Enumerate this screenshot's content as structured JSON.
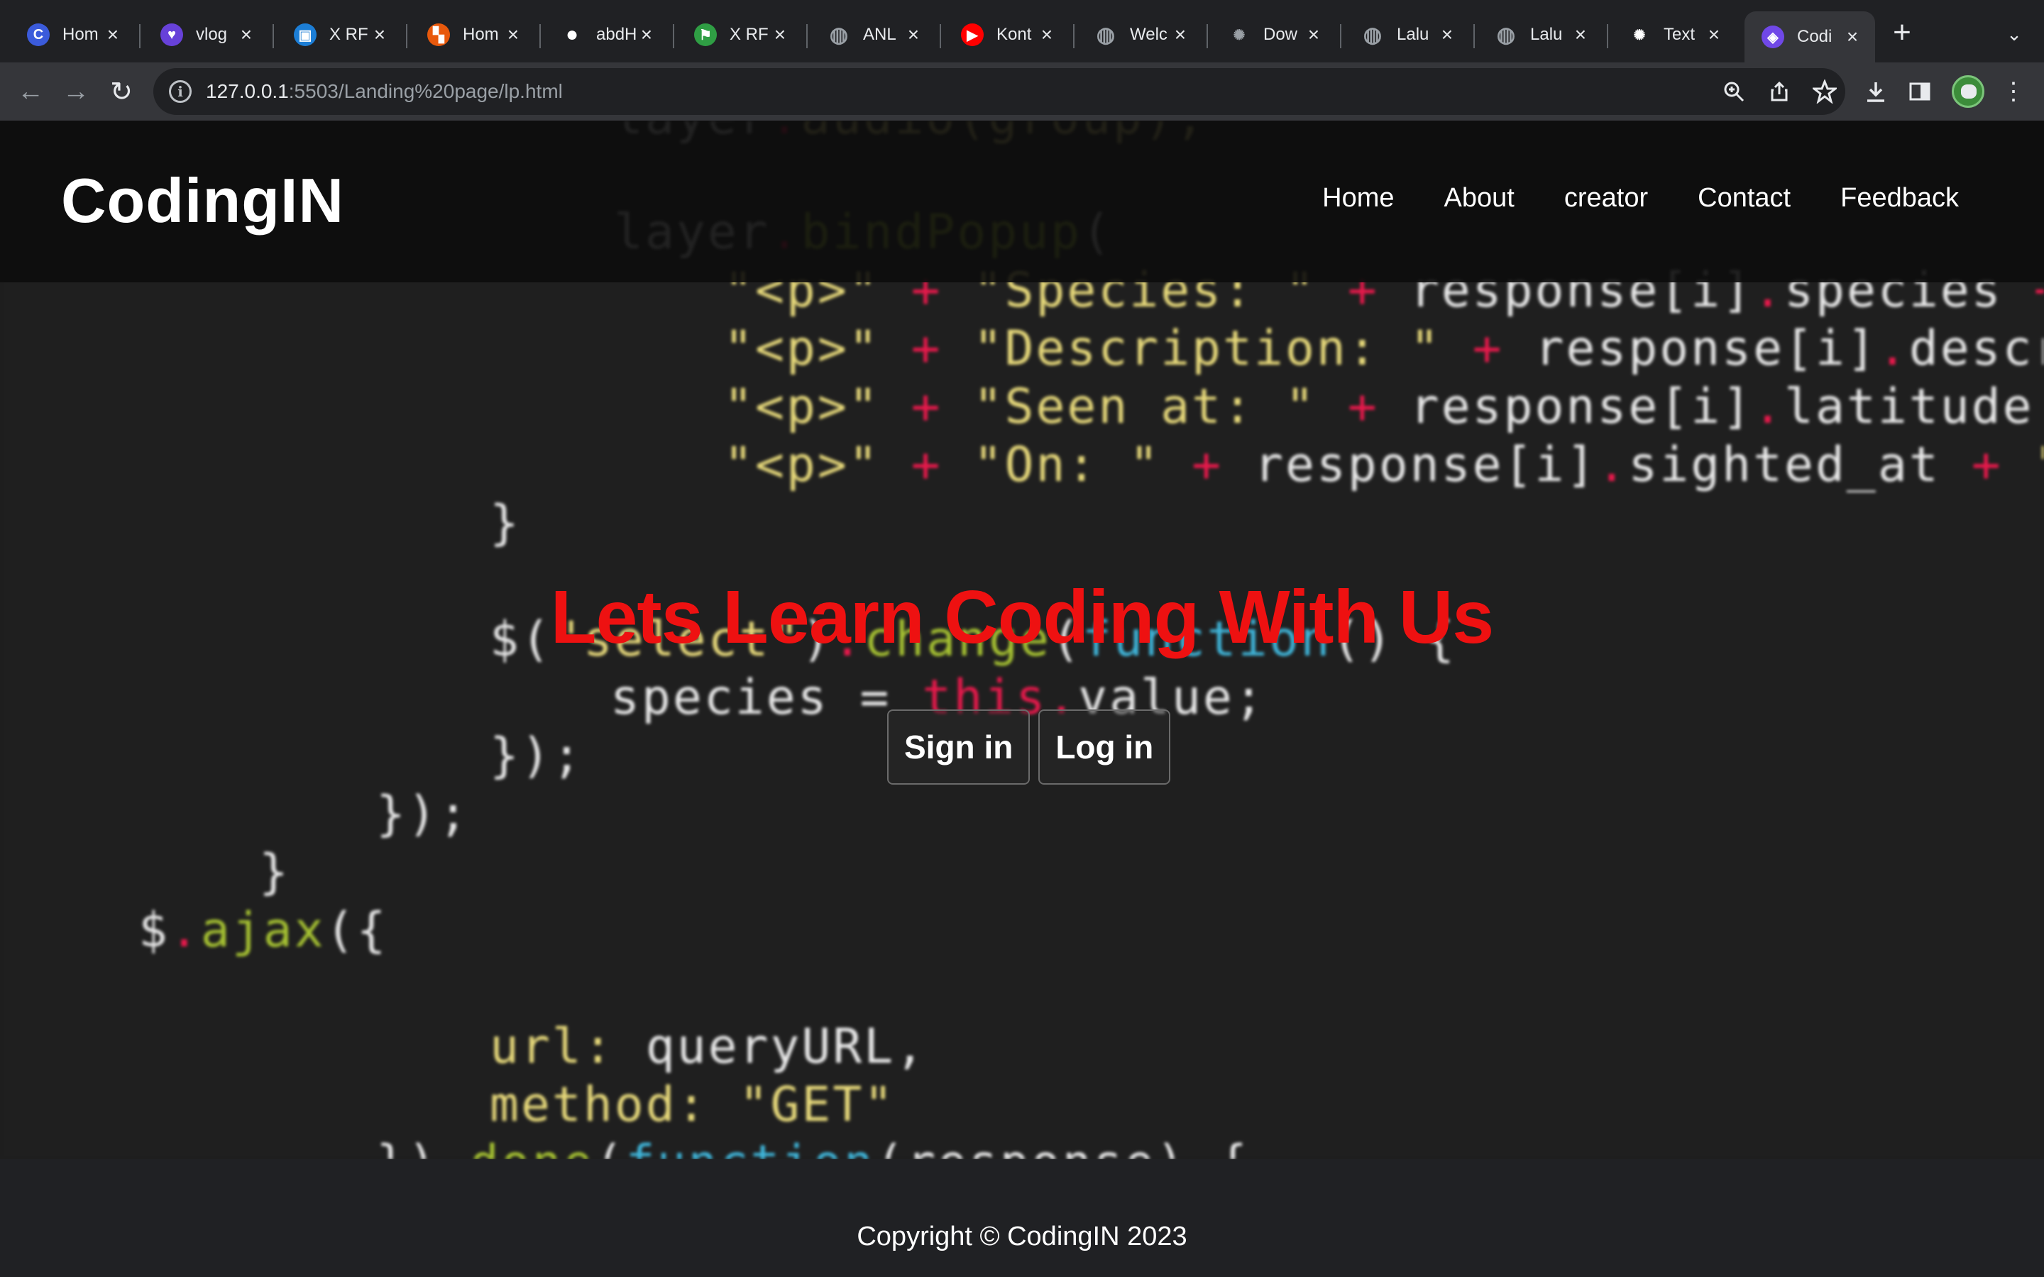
{
  "browser": {
    "tabs": [
      {
        "title": "Hom",
        "icon": "canva-icon",
        "color": "#3b5bdb"
      },
      {
        "title": "vlog",
        "icon": "heart-shield-icon",
        "color": "#6741d9"
      },
      {
        "title": "X RF",
        "icon": "user-card-icon",
        "color": "#1c7ed6"
      },
      {
        "title": "Hom",
        "icon": "blocks-icon",
        "color": "#e8590c"
      },
      {
        "title": "abdH",
        "icon": "github-icon",
        "color": "#ffffff"
      },
      {
        "title": "X RF",
        "icon": "flag-icon",
        "color": "#2f9e44"
      },
      {
        "title": "ANL",
        "icon": "globe-icon",
        "color": "#9aa0a6"
      },
      {
        "title": "Kont",
        "icon": "youtube-icon",
        "color": "#ff0000"
      },
      {
        "title": "Welc",
        "icon": "globe-icon",
        "color": "#9aa0a6"
      },
      {
        "title": "Dow",
        "icon": "openai-icon",
        "color": "#9aa0a6"
      },
      {
        "title": "Lalu",
        "icon": "globe-icon",
        "color": "#9aa0a6"
      },
      {
        "title": "Lalu",
        "icon": "globe-icon",
        "color": "#9aa0a6"
      },
      {
        "title": "Text",
        "icon": "openai-icon",
        "color": "#ffffff"
      },
      {
        "title": "Codi",
        "icon": "page-icon",
        "color": "#7048e8"
      }
    ],
    "active_tab": 13,
    "url_host": "127.0.0.1",
    "url_path": ":5503/Landing%20page/lp.html"
  },
  "site": {
    "brand": "CodingIN",
    "nav": [
      "Home",
      "About",
      "creator",
      "Contact",
      "Feedback"
    ],
    "hero_title": "Lets Learn Coding With Us",
    "signin_label": "Sign in",
    "login_label": "Log in",
    "copyright": "Copyright © CodingIN 2023"
  }
}
